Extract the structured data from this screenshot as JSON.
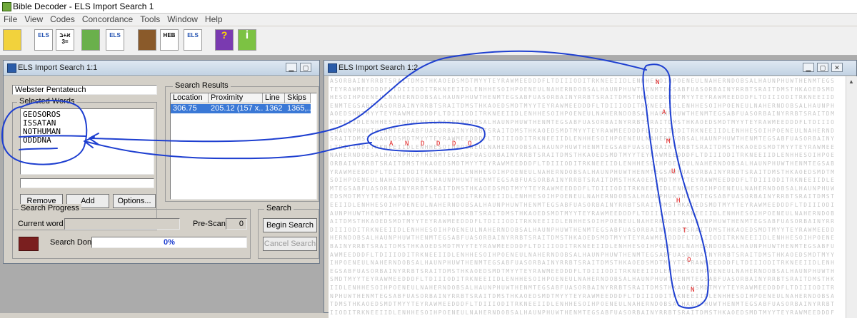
{
  "app": {
    "title": "Bible Decoder - ELS Import Search 1"
  },
  "menu": [
    "File",
    "View",
    "Codes",
    "Concordance",
    "Tools",
    "Window",
    "Help"
  ],
  "toolbar": {
    "buttons": [
      {
        "name": "scroll-tool",
        "label": ""
      },
      {
        "name": "els-hebrew-tool",
        "label": "ELS"
      },
      {
        "name": "gematria-tool",
        "label": "א+ב =3"
      },
      {
        "name": "globe-tool",
        "label": ""
      },
      {
        "name": "els-abc-tool",
        "label": "ELS"
      },
      {
        "name": "bible-book-tool",
        "label": ""
      },
      {
        "name": "heb-tool",
        "label": "HEB"
      },
      {
        "name": "els-table-tool",
        "label": "ELS"
      },
      {
        "name": "help-book-tool",
        "label": "?"
      },
      {
        "name": "info-tool",
        "label": "i"
      }
    ]
  },
  "search_window": {
    "title": "ELS Import Search 1:1",
    "bible_version": "Webster Pentateuch",
    "selected_words_label": "Selected Words",
    "selected_words": [
      "GEOSOROS",
      "ISSATAN",
      "NOTHUMAN",
      "ODDDNA"
    ],
    "remove_label": "Remove",
    "add_label": "Add",
    "options_label": "Options...",
    "results_label": "Search Results",
    "columns": [
      "Location",
      "Proximity",
      "Line",
      "Skips"
    ],
    "rows": [
      {
        "location": "306.75",
        "proximity": "205.12 (157 x...",
        "line": "1362",
        "skips": "1365,..."
      }
    ],
    "progress_label": "Search Progress",
    "current_word_label": "Current word",
    "prescan_label": "Pre-Scan",
    "prescan_value": "0",
    "search_done_label": "Search Done",
    "percent": "0%",
    "search_group_label": "Search",
    "begin_search_label": "Begin Search",
    "cancel_search_label": "Cancel Search"
  },
  "grid_window": {
    "title": "ELS Import Search 1:2",
    "horizontal_letters": [
      "A",
      "N",
      "D",
      "D",
      "D",
      "O"
    ],
    "vertical_letters": [
      "N",
      "A",
      "M",
      "U",
      "H",
      "T",
      "O",
      "N"
    ]
  },
  "colors": {
    "annotation": "#1e3fd0",
    "highlight": "#e02020",
    "selection": "#3a78d6"
  }
}
